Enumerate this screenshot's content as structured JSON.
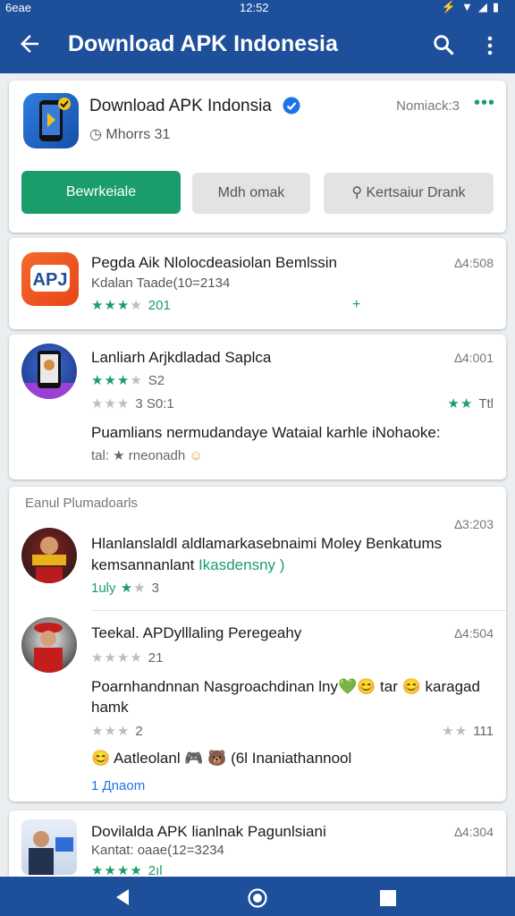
{
  "status_bar": {
    "left": "6eae",
    "time": "12:52"
  },
  "app_bar": {
    "title": "Download APK Indonesia"
  },
  "featured": {
    "name": "Download APK Indonsia",
    "meta": "Nomiack:3",
    "sub": "Mhorrs 31",
    "install_label": "Bewrkeiale",
    "secondary_label": "Mdh omak",
    "search_label": "Kertsaiur Drank"
  },
  "app1": {
    "title": "Pegda  Aik Nlolocdeasiolan Bemlssin",
    "sub": "Kdalan Taade(10=2134",
    "meta": "∆4:508",
    "rating_count": "201",
    "accent": "+"
  },
  "app2": {
    "title": "Lanliarh Arjkdladad Saplca",
    "meta": "∆4:001",
    "rating1": "S2",
    "rating2": "3 S0:1",
    "right_rating": "Ttl",
    "desc": "Puamlians nermudandaye Wataial karhle iNohaoke:",
    "footer": "tal:  ★ rneonadh"
  },
  "section": {
    "header": "Eanul Plumadoarls",
    "items": [
      {
        "meta": "∆3:203",
        "title": "Hlanlanslaldl aldlamarkasebnaimi Moley Benkatums",
        "subtitle": "kemsannanlant",
        "highlight": "Ikasdensny )",
        "rating_prefix": "1uly",
        "rating_count": "3"
      },
      {
        "meta": "∆4:504",
        "title": "Teekal. APDylllaling Peregeahy",
        "rating_count": "21",
        "desc": "Poarnhandnnan Nasgroachdinan lny💚😊 tar 😊 karagad hamk",
        "rating2": "2",
        "right_rating": "111",
        "extra": "😊 Aatleolanl 🎮 🐻 (6l Inaniathannool",
        "footer": "1 Дnaom"
      }
    ]
  },
  "last": {
    "title": "Dovilalda APK lianlnak Pagunlsiani",
    "sub": "Kantat: oaae(12=3234",
    "meta": "∆4:304",
    "rating_count": "2ıl"
  }
}
